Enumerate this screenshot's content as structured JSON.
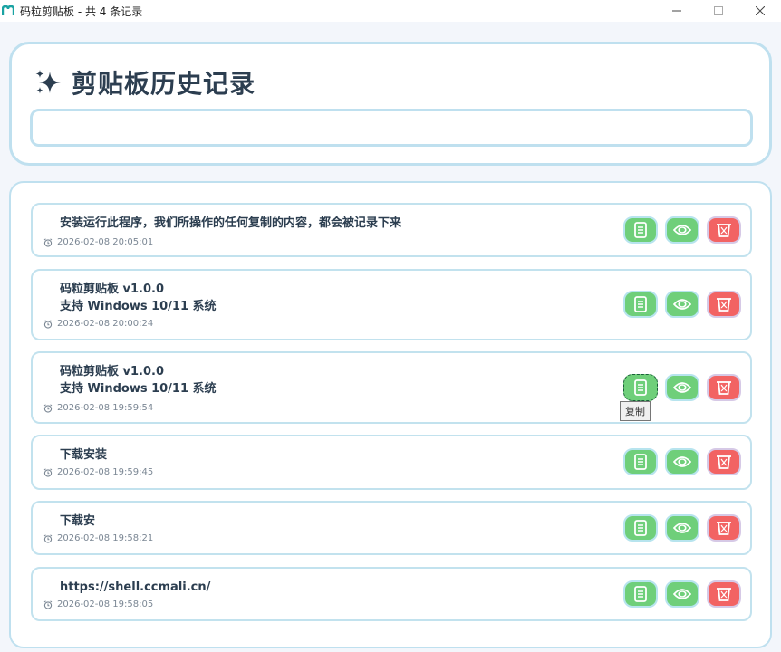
{
  "window": {
    "title": "码粒剪贴板 - 共 4 条记录",
    "controls": [
      "minimize",
      "maximize",
      "close"
    ]
  },
  "header": {
    "title": "剪贴板历史记录",
    "icon": "sparkle-icon",
    "search_value": "",
    "search_placeholder": ""
  },
  "colors": {
    "copy_button": "#6fcf7a",
    "view_button": "#6fcf7a",
    "delete_button": "#f26363",
    "card_border": "#bfe0ef"
  },
  "records": [
    {
      "text": "安装运行此程序，我们所操作的任何复制的内容，都会被记录下来",
      "time": "2026-02-08 20:05:01"
    },
    {
      "text": "码粒剪贴板 v1.0.0\n支持 Windows 10/11 系统",
      "time": "2026-02-08 20:00:24"
    },
    {
      "text": "码粒剪贴板 v1.0.0\n支持 Windows 10/11 系统",
      "time": "2026-02-08 19:59:54"
    },
    {
      "text": "下载安装",
      "time": "2026-02-08 19:59:45"
    },
    {
      "text": "下载安",
      "time": "2026-02-08 19:58:21"
    },
    {
      "text": "https://shell.ccmali.cn/",
      "time": "2026-02-08 19:58:05"
    }
  ],
  "tooltip": {
    "text": "复制"
  }
}
